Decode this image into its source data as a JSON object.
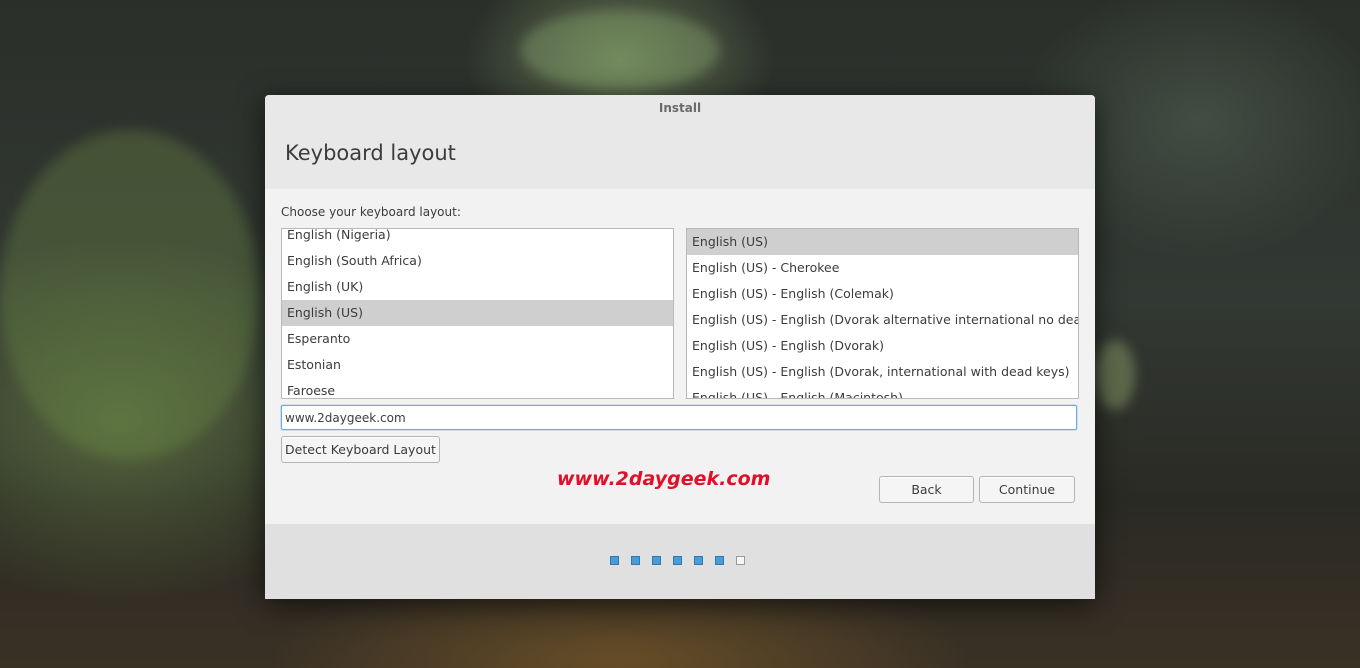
{
  "window": {
    "title": "Install"
  },
  "page": {
    "title": "Keyboard layout",
    "prompt": "Choose your keyboard layout:"
  },
  "layouts": {
    "items": [
      {
        "label": "English (Nigeria)",
        "selected": false
      },
      {
        "label": "English (South Africa)",
        "selected": false
      },
      {
        "label": "English (UK)",
        "selected": false
      },
      {
        "label": "English (US)",
        "selected": true
      },
      {
        "label": "Esperanto",
        "selected": false
      },
      {
        "label": "Estonian",
        "selected": false
      },
      {
        "label": "Faroese",
        "selected": false
      }
    ]
  },
  "variants": {
    "items": [
      {
        "label": "English (US)",
        "selected": true
      },
      {
        "label": "English (US) - Cherokee",
        "selected": false
      },
      {
        "label": "English (US) - English (Colemak)",
        "selected": false
      },
      {
        "label": "English (US) - English (Dvorak alternative international no dead keys)",
        "selected": false
      },
      {
        "label": "English (US) - English (Dvorak)",
        "selected": false
      },
      {
        "label": "English (US) - English (Dvorak, international with dead keys)",
        "selected": false
      },
      {
        "label": "English (US) - English (Macintosh)",
        "selected": false
      }
    ]
  },
  "test_input": {
    "value": "www.2daygeek.com"
  },
  "buttons": {
    "detect": "Detect Keyboard Layout",
    "back": "Back",
    "continue": "Continue"
  },
  "watermark": "www.2daygeek.com",
  "progress": {
    "total": 7,
    "completed": 6
  }
}
